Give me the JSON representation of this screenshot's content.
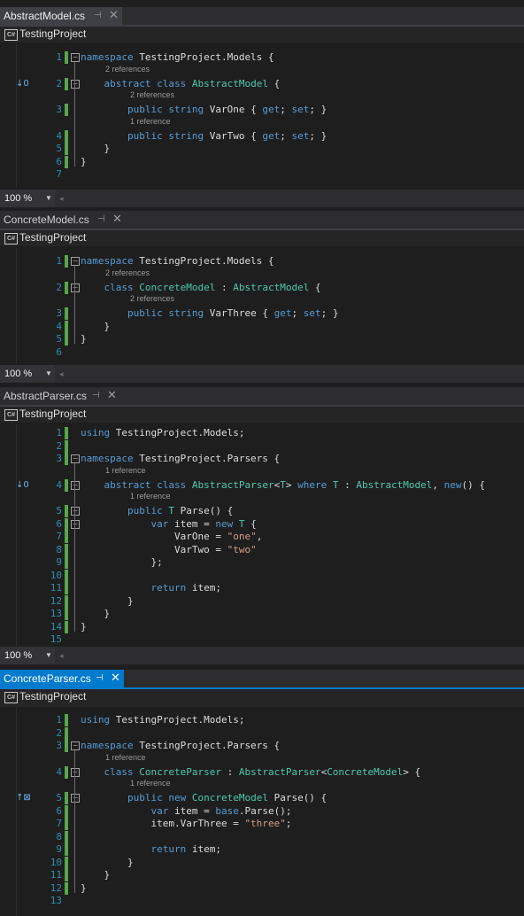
{
  "panes": [
    {
      "tab": "AbstractModel.cs",
      "project": "TestingProject",
      "zoom": "100 %",
      "lines": [
        {
          "n": "1",
          "html": "<span class='kw'>namespace</span> TestingProject.Models {"
        },
        {
          "ref": "2 references",
          "n": "2",
          "html": "    <span class='kw'>abstract</span> <span class='kw'>class</span> <span class='ty'>AbstractModel</span> {",
          "glyph": "↓0"
        },
        {
          "ref": "2 references",
          "n": "3",
          "html": "        <span class='kw'>public</span> <span class='kw'>string</span> VarOne { <span class='kw'>get</span>; <span class='kw'>set</span>; }"
        },
        {
          "ref": "1 reference",
          "n": "4",
          "html": "        <span class='kw'>public</span> <span class='kw'>string</span> VarTwo { <span class='kw'>get</span>; <span class='kw'>set</span>; }"
        },
        {
          "n": "5",
          "html": "    }"
        },
        {
          "n": "6",
          "html": "}"
        },
        {
          "n": "7",
          "html": ""
        }
      ]
    },
    {
      "tab": "ConcreteModel.cs",
      "project": "TestingProject",
      "zoom": "100 %",
      "lines": [
        {
          "n": "1",
          "html": "<span class='kw'>namespace</span> TestingProject.Models {"
        },
        {
          "ref": "2 references",
          "n": "2",
          "html": "    <span class='kw'>class</span> <span class='ty'>ConcreteModel</span> : <span class='ty'>AbstractModel</span> {"
        },
        {
          "ref": "2 references",
          "n": "3",
          "html": "        <span class='kw'>public</span> <span class='kw'>string</span> VarThree { <span class='kw'>get</span>; <span class='kw'>set</span>; }"
        },
        {
          "n": "4",
          "html": "    }"
        },
        {
          "n": "5",
          "html": "}"
        },
        {
          "n": "6",
          "html": ""
        }
      ]
    },
    {
      "tab": "AbstractParser.cs",
      "project": "TestingProject",
      "zoom": "100 %",
      "lines": [
        {
          "n": "1",
          "html": "<span class='kw'>using</span> TestingProject.Models;"
        },
        {
          "n": "2",
          "html": ""
        },
        {
          "n": "3",
          "html": "<span class='kw'>namespace</span> TestingProject.Parsers {"
        },
        {
          "ref": "1 reference",
          "n": "4",
          "html": "    <span class='kw'>abstract</span> <span class='kw'>class</span> <span class='ty'>AbstractParser</span>&lt;<span class='ty'>T</span>&gt; <span class='kw'>where</span> <span class='ty'>T</span> : <span class='ty'>AbstractModel</span>, <span class='kw'>new</span>() {",
          "glyph": "↓0"
        },
        {
          "ref": "1 reference",
          "n": "5",
          "html": "        <span class='kw'>public</span> <span class='ty'>T</span> Parse() {"
        },
        {
          "n": "6",
          "html": "            <span class='kw'>var</span> item = <span class='kw'>new</span> <span class='ty'>T</span> {"
        },
        {
          "n": "7",
          "html": "                VarOne = <span class='st'>\"one\"</span>,"
        },
        {
          "n": "8",
          "html": "                VarTwo = <span class='st'>\"two\"</span>"
        },
        {
          "n": "9",
          "html": "            };"
        },
        {
          "n": "10",
          "html": ""
        },
        {
          "n": "11",
          "html": "            <span class='kw'>return</span> item;"
        },
        {
          "n": "12",
          "html": "        }"
        },
        {
          "n": "13",
          "html": "    }"
        },
        {
          "n": "14",
          "html": "}"
        },
        {
          "n": "15",
          "html": ""
        }
      ]
    },
    {
      "tab": "ConcreteParser.cs",
      "project": "TestingProject",
      "lines": [
        {
          "n": "1",
          "html": "<span class='kw'>using</span> TestingProject.Models;"
        },
        {
          "n": "2",
          "html": ""
        },
        {
          "n": "3",
          "html": "<span class='kw'>namespace</span> TestingProject.Parsers {"
        },
        {
          "ref": "1 reference",
          "n": "4",
          "html": "    <span class='kw'>class</span> <span class='ty'>ConcreteParser</span> : <span class='ty'>AbstractParser</span>&lt;<span class='ty'>ConcreteModel</span>&gt; {"
        },
        {
          "ref": "1 reference",
          "n": "5",
          "html": "        <span class='kw'>public</span> <span class='kw'>new</span> <span class='ty'>ConcreteModel</span> Parse() {",
          "glyph": "↑⊠"
        },
        {
          "n": "6",
          "html": "            <span class='kw'>var</span> item = <span class='kw'>base</span>.Parse();"
        },
        {
          "n": "7",
          "html": "            item.VarThree = <span class='st'>\"three\"</span>;"
        },
        {
          "n": "8",
          "html": ""
        },
        {
          "n": "9",
          "html": "            <span class='kw'>return</span> item;"
        },
        {
          "n": "10",
          "html": "        }"
        },
        {
          "n": "11",
          "html": "    }"
        },
        {
          "n": "12",
          "html": "}"
        },
        {
          "n": "13",
          "html": ""
        }
      ]
    }
  ]
}
